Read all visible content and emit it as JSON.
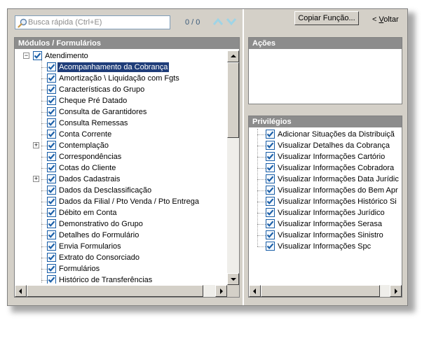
{
  "search": {
    "placeholder": "Busca rápida (Ctrl+E)",
    "counter": "0 / 0"
  },
  "toolbar": {
    "copy_label": "Copiar Função...",
    "back_arrow": "<",
    "back_accel": "V",
    "back_rest": "oltar"
  },
  "modules": {
    "header": "Módulos / Formulários",
    "root": "Atendimento",
    "items": [
      {
        "label": "Acompanhamento da Cobrança",
        "selected": true
      },
      {
        "label": "Amortização \\ Liquidação com Fgts"
      },
      {
        "label": "Características do Grupo"
      },
      {
        "label": "Cheque Pré Datado"
      },
      {
        "label": "Consulta de Garantidores"
      },
      {
        "label": "Consulta Remessas"
      },
      {
        "label": "Conta Corrente"
      },
      {
        "label": "Contemplação",
        "expandable": true
      },
      {
        "label": "Correspondências"
      },
      {
        "label": "Cotas do Cliente"
      },
      {
        "label": "Dados Cadastrais",
        "expandable": true
      },
      {
        "label": "Dados da Desclassificação"
      },
      {
        "label": "Dados da Filial / Pto Venda / Pto Entrega"
      },
      {
        "label": "Débito em Conta"
      },
      {
        "label": "Demonstrativo do Grupo"
      },
      {
        "label": "Detalhes do Formulário"
      },
      {
        "label": "Envia Formularios"
      },
      {
        "label": "Extrato do Consorciado"
      },
      {
        "label": "Formulários"
      },
      {
        "label": "Histórico de Transferências"
      }
    ]
  },
  "acoes": {
    "header": "Ações"
  },
  "privilegios": {
    "header": "Privilégios",
    "items": [
      "Adicionar Situações da Distribuiçã",
      "Visualizar Detalhes da Cobrança",
      "Visualizar Informações Cartório",
      "Visualizar Informações Cobradora",
      "Visualizar Informações Data Jurídic",
      "Visualizar Informações do Bem Apr",
      "Visualizar Informações Histórico Si",
      "Visualizar Informações Jurídico",
      "Visualizar Informações Serasa",
      "Visualizar Informações Sinistro",
      "Visualizar Informações Spc"
    ]
  },
  "colors": {
    "selection": "#1f3d79",
    "header_bg": "#8c8c8c",
    "window_bg": "#d4d0c8",
    "check": "#1b5fa8"
  }
}
